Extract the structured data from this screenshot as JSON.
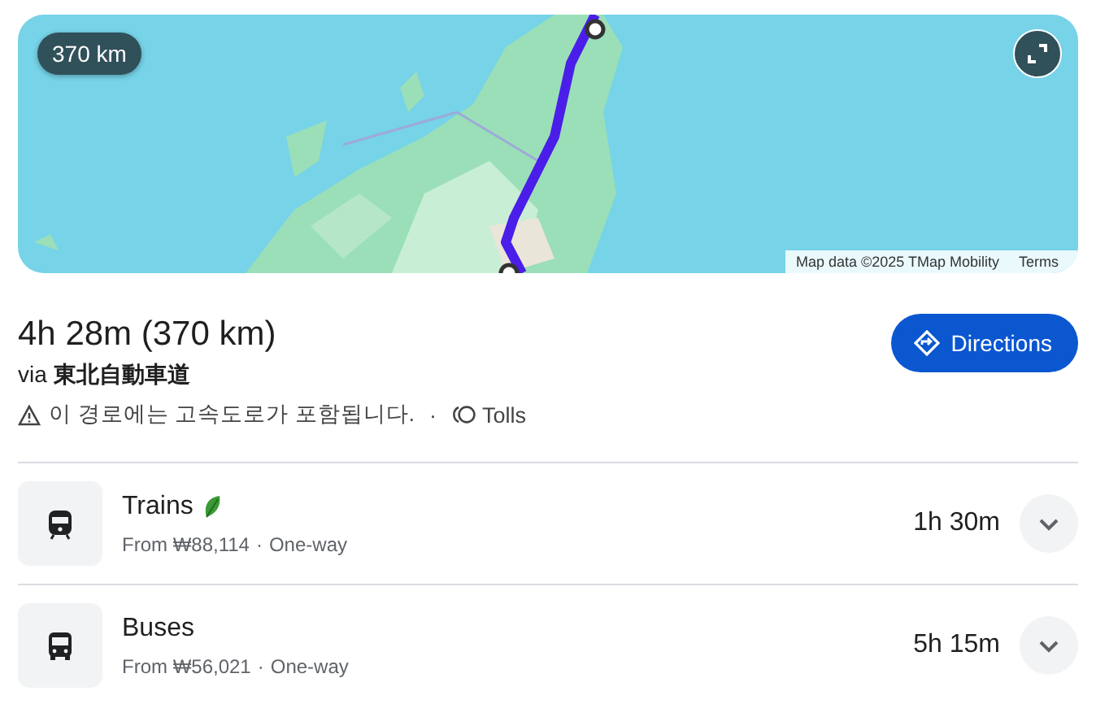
{
  "map": {
    "kind": "picture",
    "distance_badge": "370 km",
    "attribution": "Map data ©2025 TMap Mobility",
    "terms_link": "Terms"
  },
  "summary": {
    "duration": "4h 28m (370 km)",
    "via": "via **東北自動車道**",
    "warning": "이 경로에는 고속도로가 포함됩니다.",
    "separator": "·",
    "tolls": "Tolls",
    "directions_button": "Directions"
  },
  "options": [
    {
      "kind": "train",
      "title": "Trains",
      "eco": true,
      "price": "From ₩88,114",
      "separator": "·",
      "trip": "One-way",
      "duration": "1h 30m",
      "expanded": false
    },
    {
      "kind": "bus",
      "title": "Buses",
      "eco": false,
      "price": "From ₩56,021",
      "separator": "·",
      "trip": "One-way",
      "duration": "5h 15m",
      "expanded": false
    }
  ]
}
